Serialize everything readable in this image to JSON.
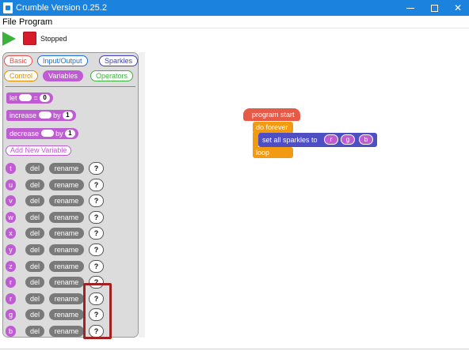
{
  "window": {
    "title": "Crumble Version 0.25.2",
    "controls": {
      "minimize": "minimize",
      "maximize": "maximize",
      "close": "✕"
    }
  },
  "menu": {
    "file": "File",
    "program": "Program"
  },
  "toolbar": {
    "status": "Stopped"
  },
  "palette": {
    "tabs": {
      "basic": "Basic",
      "io": "Input/Output",
      "sparkles": "Sparkles",
      "control": "Control",
      "variables": "Variables",
      "operators": "Operators"
    },
    "blocks": {
      "let_label": "let",
      "let_eq": "=",
      "let_value": "0",
      "increase_label": "increase",
      "increase_by": "by",
      "increase_value": "1",
      "decrease_label": "decrease",
      "decrease_by": "by",
      "decrease_value": "1"
    },
    "add_variable": "Add New Variable",
    "del_label": "del",
    "rename_label": "rename",
    "help_label": "?",
    "variables": [
      "t",
      "u",
      "v",
      "w",
      "x",
      "y",
      "z",
      "r",
      "r",
      "g",
      "b"
    ]
  },
  "canvas": {
    "program_start": "program start",
    "do_forever": "do forever",
    "set_sparkles": "set all sparkles to",
    "args": {
      "r": "r",
      "g": "g",
      "b": "b"
    },
    "loop": "loop"
  },
  "colors": {
    "titlebar": "#1b83dd",
    "variables": "#c05cd3",
    "control": "#f29a11",
    "sparkles": "#4f4fc4",
    "program_start": "#e85a48",
    "highlight": "#a02222"
  },
  "icons": {
    "app": "crumble-app-icon",
    "play": "play-icon",
    "stop": "stop-icon"
  }
}
